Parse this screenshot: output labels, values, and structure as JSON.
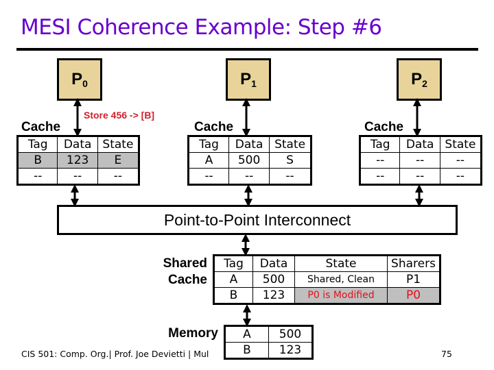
{
  "slide": {
    "title": "MESI Coherence Example: Step #6",
    "footer": "CIS 501: Comp. Org.| Prof. Joe Devietti | Mul",
    "page_number": "75"
  },
  "colors": {
    "title": "#6600cc",
    "processor_fill": "#e8d49a",
    "highlight_fill": "#bfbfbf",
    "annotation_red": "#e0101a"
  },
  "processors": [
    {
      "name": "P",
      "subscript": "0",
      "cache_label": "Cache",
      "headers": [
        "Tag",
        "Data",
        "State"
      ],
      "rows": [
        {
          "cells": [
            "B",
            "123",
            "E"
          ],
          "highlighted": true
        },
        {
          "cells": [
            "--",
            "--",
            "--"
          ],
          "highlighted": false
        }
      ],
      "annotation": "Store 456 -> [B]"
    },
    {
      "name": "P",
      "subscript": "1",
      "cache_label": "Cache",
      "headers": [
        "Tag",
        "Data",
        "State"
      ],
      "rows": [
        {
          "cells": [
            "A",
            "500",
            "S"
          ],
          "highlighted": false
        },
        {
          "cells": [
            "--",
            "--",
            "--"
          ],
          "highlighted": false
        }
      ]
    },
    {
      "name": "P",
      "subscript": "2",
      "cache_label": "Cache",
      "headers": [
        "Tag",
        "Data",
        "State"
      ],
      "rows": [
        {
          "cells": [
            "--",
            "--",
            "--"
          ],
          "highlighted": false
        },
        {
          "cells": [
            "--",
            "--",
            "--"
          ],
          "highlighted": false
        }
      ]
    }
  ],
  "interconnect": {
    "label": "Point-to-Point Interconnect"
  },
  "shared_cache": {
    "label_line1": "Shared",
    "label_line2": "Cache",
    "headers": [
      "Tag",
      "Data",
      "State",
      "Sharers"
    ],
    "rows": [
      {
        "tag": "A",
        "data": "500",
        "state": "Shared, Clean",
        "sharers": "P1",
        "highlighted": false
      },
      {
        "tag": "B",
        "data": "123",
        "state": "P0 is Modified",
        "sharers": "P0",
        "highlighted": true
      }
    ]
  },
  "memory": {
    "label": "Memory",
    "rows": [
      {
        "addr": "A",
        "value": "500"
      },
      {
        "addr": "B",
        "value": "123"
      }
    ]
  }
}
